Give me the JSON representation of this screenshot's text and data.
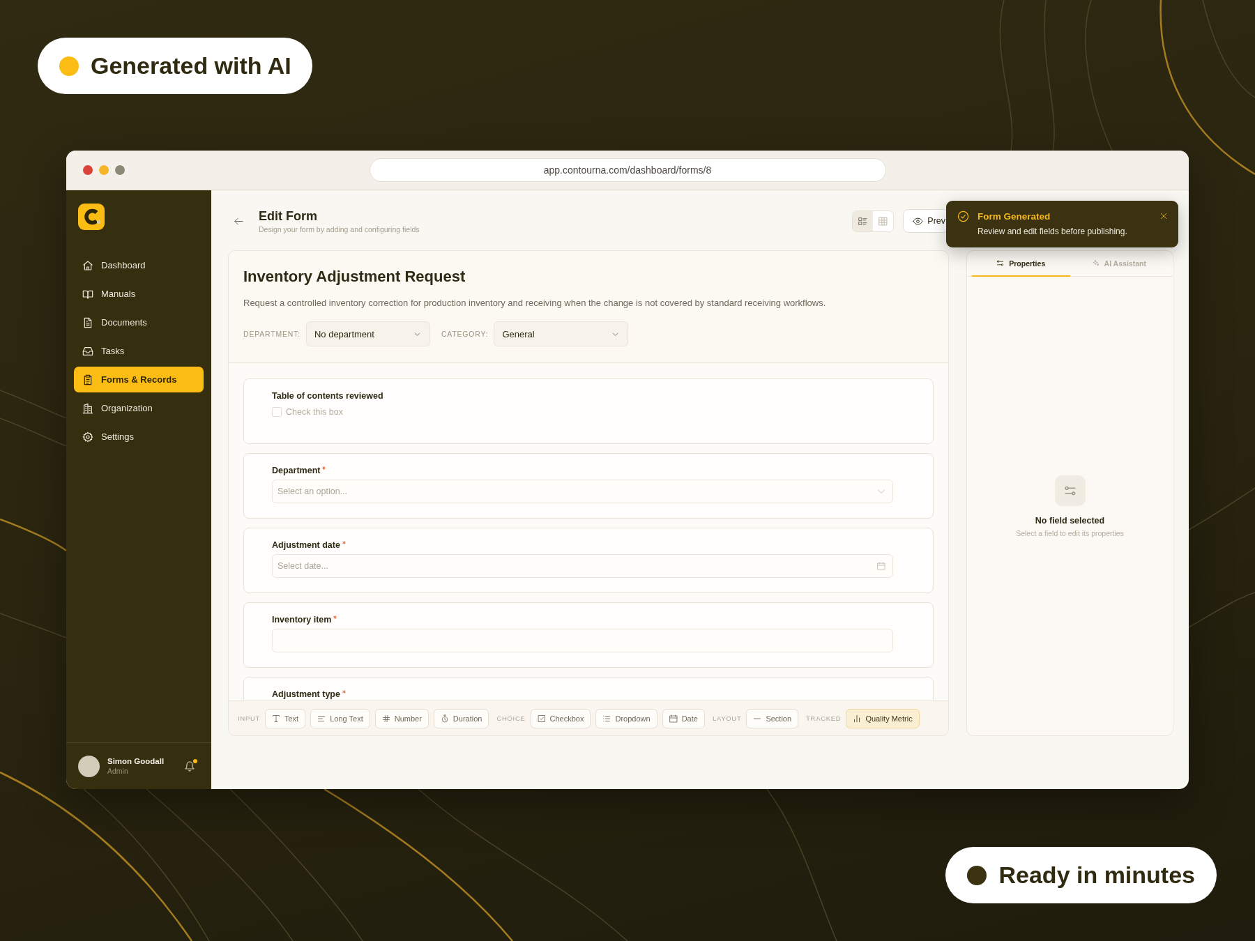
{
  "badges": [
    {
      "label": "Generated with AI",
      "color": "#fbbc13"
    },
    {
      "label": "Ready in minutes",
      "color": "#3a3210"
    }
  ],
  "browser": {
    "url": "app.contourna.com/dashboard/forms/8"
  },
  "sidebar": {
    "nav": [
      {
        "label": "Dashboard",
        "selected": false
      },
      {
        "label": "Manuals",
        "selected": false
      },
      {
        "label": "Documents",
        "selected": false
      },
      {
        "label": "Tasks",
        "selected": false
      },
      {
        "label": "Forms & Records",
        "selected": true
      },
      {
        "label": "Organization",
        "selected": false
      },
      {
        "label": "Settings",
        "selected": false
      }
    ],
    "user": {
      "name": "Simon Goodall",
      "role": "Admin"
    },
    "notifications": {
      "unread": true
    }
  },
  "header": {
    "title": "Edit Form",
    "subtitle": "Design your form by adding and configuring fields",
    "view_modes": [
      {
        "selected": true
      },
      {
        "selected": false
      }
    ],
    "preview_button": {
      "label": "Prev"
    }
  },
  "toast": {
    "title": "Form Generated",
    "message": "Review and edit fields before publishing."
  },
  "form": {
    "title": "Inventory Adjustment Request",
    "description": "Request a controlled inventory correction for production inventory and receiving when the change is not covered by standard receiving workflows.",
    "filters": [
      {
        "label": "DEPARTMENT:",
        "value": "No department"
      },
      {
        "label": "CATEGORY:",
        "value": "General"
      }
    ],
    "fields": [
      {
        "label": "Table of contents reviewed",
        "required": false,
        "kind": "checkbox",
        "option_label": "Check this box",
        "checked": false
      },
      {
        "label": "Department",
        "required": true,
        "kind": "select",
        "placeholder": "Select an option..."
      },
      {
        "label": "Adjustment date",
        "required": true,
        "kind": "date",
        "placeholder": "Select date..."
      },
      {
        "label": "Inventory item",
        "required": true,
        "kind": "text"
      },
      {
        "label": "Adjustment type",
        "required": true
      }
    ],
    "toolbar": {
      "groups": [
        {
          "label": "INPUT",
          "tools": [
            {
              "label": "Text",
              "highlighted": false
            },
            {
              "label": "Long Text",
              "highlighted": false
            },
            {
              "label": "Number",
              "highlighted": false
            },
            {
              "label": "Duration",
              "highlighted": false
            }
          ]
        },
        {
          "label": "CHOICE",
          "tools": [
            {
              "label": "Checkbox",
              "highlighted": false
            },
            {
              "label": "Dropdown",
              "highlighted": false
            },
            {
              "label": "Date",
              "highlighted": false
            }
          ]
        },
        {
          "label": "LAYOUT",
          "tools": [
            {
              "label": "Section",
              "highlighted": false
            }
          ]
        },
        {
          "label": "TRACKED",
          "tools": [
            {
              "label": "Quality Metric",
              "highlighted": true
            }
          ]
        }
      ]
    }
  },
  "properties_panel": {
    "tabs": [
      {
        "label": "Properties",
        "selected": true
      },
      {
        "label": "AI Assistant",
        "selected": false
      }
    ],
    "empty_state": {
      "title": "No field selected",
      "hint": "Select a field to edit its properties"
    }
  }
}
